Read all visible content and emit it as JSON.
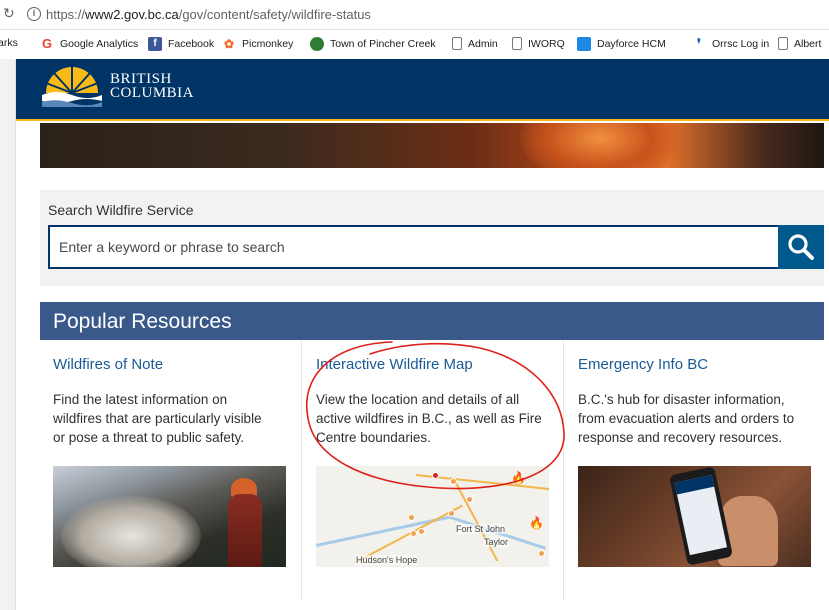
{
  "browser": {
    "url_prefix": "https://",
    "url_host": "www2.gov.bc.ca",
    "url_path": "/gov/content/safety/wildfire-status",
    "bookmarks": [
      {
        "label": "arks",
        "icon": "none"
      },
      {
        "label": "Google Analytics",
        "icon": "google-icon",
        "color": "#4285f4"
      },
      {
        "label": "Facebook",
        "icon": "facebook-icon",
        "color": "#3b5998"
      },
      {
        "label": "Picmonkey",
        "icon": "picmonkey-icon",
        "color": "#f26a2b"
      },
      {
        "label": "Town of Pincher Creek",
        "icon": "town-icon",
        "color": "#2e7d32"
      },
      {
        "label": "Admin",
        "icon": "page-icon"
      },
      {
        "label": "IWORQ",
        "icon": "page-icon"
      },
      {
        "label": "Dayforce HCM",
        "icon": "dayforce-icon",
        "color": "#1e88e5"
      },
      {
        "label": "Orrsc Log in",
        "icon": "orrsc-icon",
        "color": "#1565c0"
      },
      {
        "label": "Albert",
        "icon": "page-icon"
      }
    ]
  },
  "header": {
    "logo_line1": "BRITISH",
    "logo_line2": "COLUMBIA"
  },
  "search": {
    "label": "Search Wildfire Service",
    "placeholder": "Enter a keyword or phrase to search"
  },
  "popular": {
    "title": "Popular Resources",
    "cards": [
      {
        "title": "Wildfires of Note",
        "desc_lines": [
          "Find the latest information on",
          "wildfires that are particularly visible",
          "or pose a threat to public safety."
        ]
      },
      {
        "title": "Interactive Wildfire Map",
        "desc_lines": [
          "View the location and details of all",
          "active wildfires in B.C., as well as Fire",
          "Centre boundaries."
        ],
        "map_labels": [
          "Fort St John",
          "Taylor",
          "Hudson's Hope"
        ]
      },
      {
        "title": "Emergency Info BC",
        "desc_lines": [
          "B.C.'s hub for disaster information,",
          "from evacuation alerts and orders to",
          "response and recovery resources."
        ]
      }
    ]
  },
  "colors": {
    "header_blue": "#003366",
    "accent_gold": "#fcba19",
    "section_blue": "#38598a",
    "link_blue": "#1a5a96",
    "annotation_red": "#e0201a"
  }
}
